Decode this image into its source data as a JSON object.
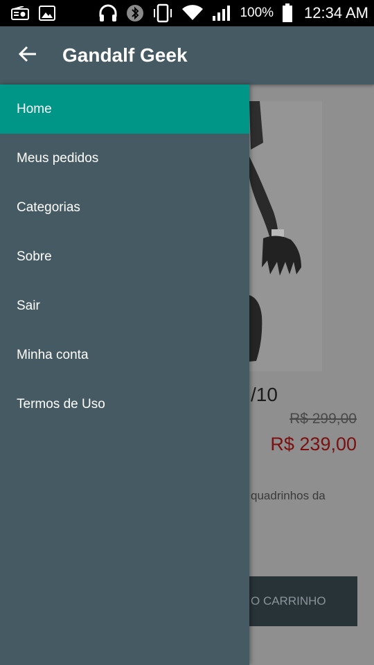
{
  "status_bar": {
    "battery": "100%",
    "time": "12:34 AM",
    "icons": [
      "radio-icon",
      "image-icon",
      "headphones-icon",
      "bluetooth-icon",
      "vibrate-icon",
      "wifi-icon",
      "signal-icon",
      "battery-icon"
    ]
  },
  "app_bar": {
    "title": "Gandalf Geek",
    "back_icon": "arrow-back-icon"
  },
  "drawer": {
    "items": [
      {
        "label": "Home",
        "active": true
      },
      {
        "label": "Meus pedidos",
        "active": false
      },
      {
        "label": "Categorias",
        "active": false
      },
      {
        "label": "Sobre",
        "active": false
      },
      {
        "label": "Sair",
        "active": false
      },
      {
        "label": "Minha conta",
        "active": false
      },
      {
        "label": "Termos de Uso",
        "active": false
      }
    ]
  },
  "background_page": {
    "product_name_partial": "/10",
    "old_price": "R$ 299,00",
    "new_price": "R$ 239,00",
    "description_partial": "quadrinhos da",
    "cart_button_partial": "O CARRINHO"
  },
  "colors": {
    "app_bar": "#455a62",
    "drawer": "#455a62",
    "active_item": "#009687",
    "new_price": "#c62828"
  }
}
